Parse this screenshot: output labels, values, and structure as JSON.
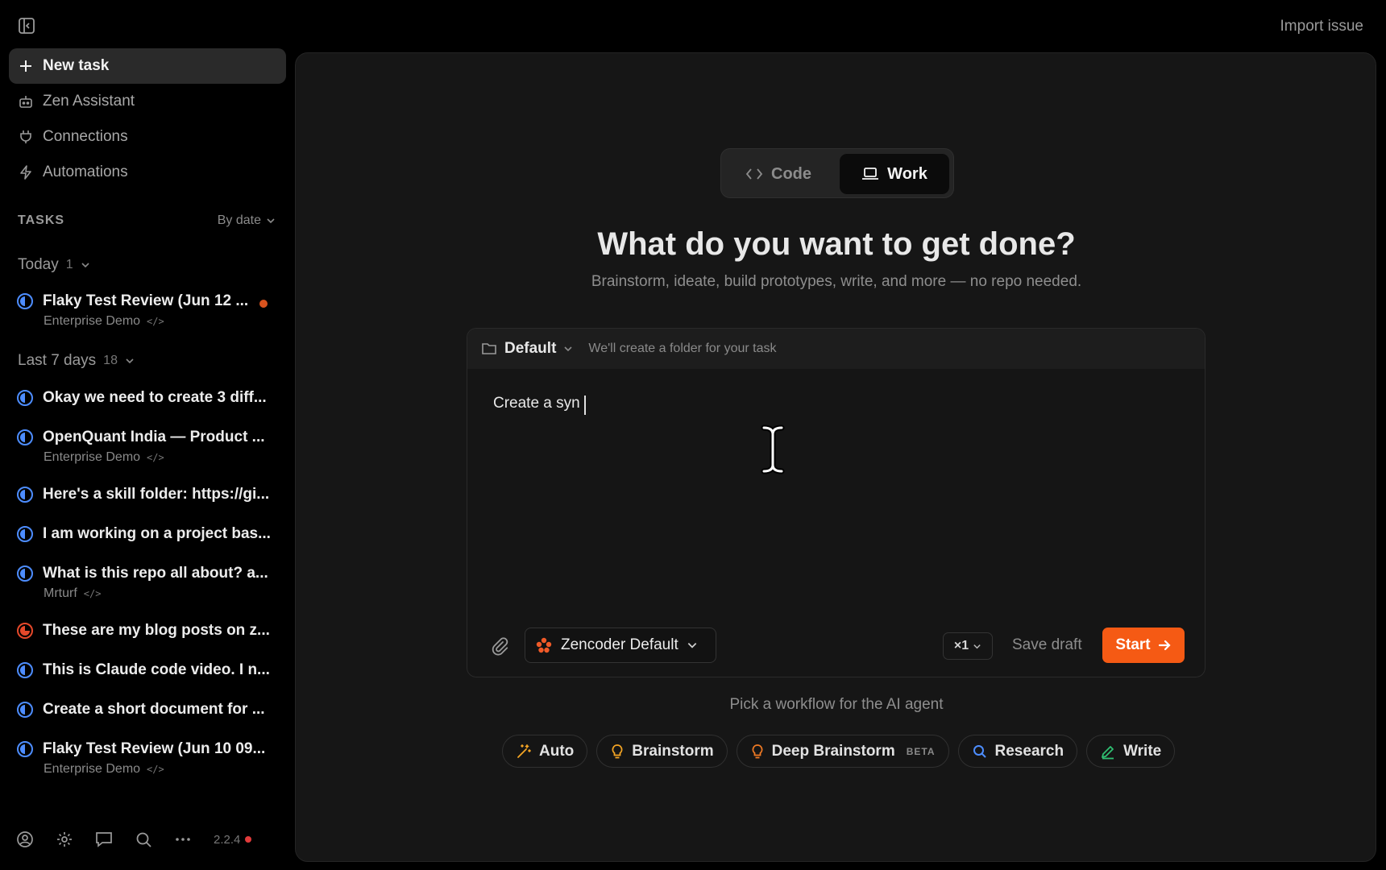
{
  "topbar": {
    "import_issue": "Import issue"
  },
  "sidebar": {
    "nav": [
      {
        "label": "New task",
        "icon": "plus-icon"
      },
      {
        "label": "Zen Assistant",
        "icon": "robot-icon"
      },
      {
        "label": "Connections",
        "icon": "plug-icon"
      },
      {
        "label": "Automations",
        "icon": "bolt-icon"
      }
    ],
    "tasks_title": "TASKS",
    "sort_label": "By date",
    "groups": [
      {
        "label": "Today",
        "count": "1"
      },
      {
        "label": "Last 7 days",
        "count": "18"
      }
    ],
    "tasks": [
      {
        "title": "Flaky Test Review (Jun 12 ...",
        "subtitle": "Enterprise Demo",
        "status": "in-progress",
        "unread": true
      },
      {
        "title": "Okay we need to create 3 diff...",
        "subtitle": "",
        "status": "in-progress"
      },
      {
        "title": "OpenQuant India — Product ...",
        "subtitle": "Enterprise Demo",
        "status": "in-progress"
      },
      {
        "title": "Here's a skill folder: https://gi...",
        "subtitle": "",
        "status": "in-progress"
      },
      {
        "title": "I am working on a project bas...",
        "subtitle": "",
        "status": "in-progress"
      },
      {
        "title": "What is this repo all about? a...",
        "subtitle": "Mrturf",
        "status": "in-progress"
      },
      {
        "title": "These are my blog posts on z...",
        "subtitle": "",
        "status": "error"
      },
      {
        "title": "This is Claude code video. I n...",
        "subtitle": "",
        "status": "in-progress"
      },
      {
        "title": "Create a short document for ...",
        "subtitle": "",
        "status": "in-progress"
      },
      {
        "title": "Flaky Test Review (Jun 10 09...",
        "subtitle": "Enterprise Demo",
        "status": "in-progress"
      }
    ],
    "code_glyph": "</>",
    "version": "2.2.4"
  },
  "main": {
    "modes": {
      "code": "Code",
      "work": "Work",
      "active": "Work"
    },
    "heading": "What do you want to get done?",
    "subheading": "Brainstorm, ideate, build prototypes, write, and more — no repo needed.",
    "composer": {
      "folder": "Default",
      "folder_hint": "We'll create a folder for your task",
      "prompt_value": "Create a syn",
      "model": "Zencoder Default",
      "count": "×1",
      "save_draft": "Save draft",
      "start": "Start"
    },
    "workflow_hint": "Pick a workflow for the AI agent",
    "workflows": [
      {
        "label": "Auto",
        "icon": "magic-wand-icon"
      },
      {
        "label": "Brainstorm",
        "icon": "lightbulb-icon"
      },
      {
        "label": "Deep Brainstorm",
        "icon": "lightbulb-icon",
        "badge": "BETA"
      },
      {
        "label": "Research",
        "icon": "search-icon"
      },
      {
        "label": "Write",
        "icon": "pencil-icon"
      }
    ]
  },
  "colors": {
    "accent": "#f55a14",
    "in_progress": "#4d8dff",
    "error": "#e5482a",
    "unread": "#d9531e"
  }
}
